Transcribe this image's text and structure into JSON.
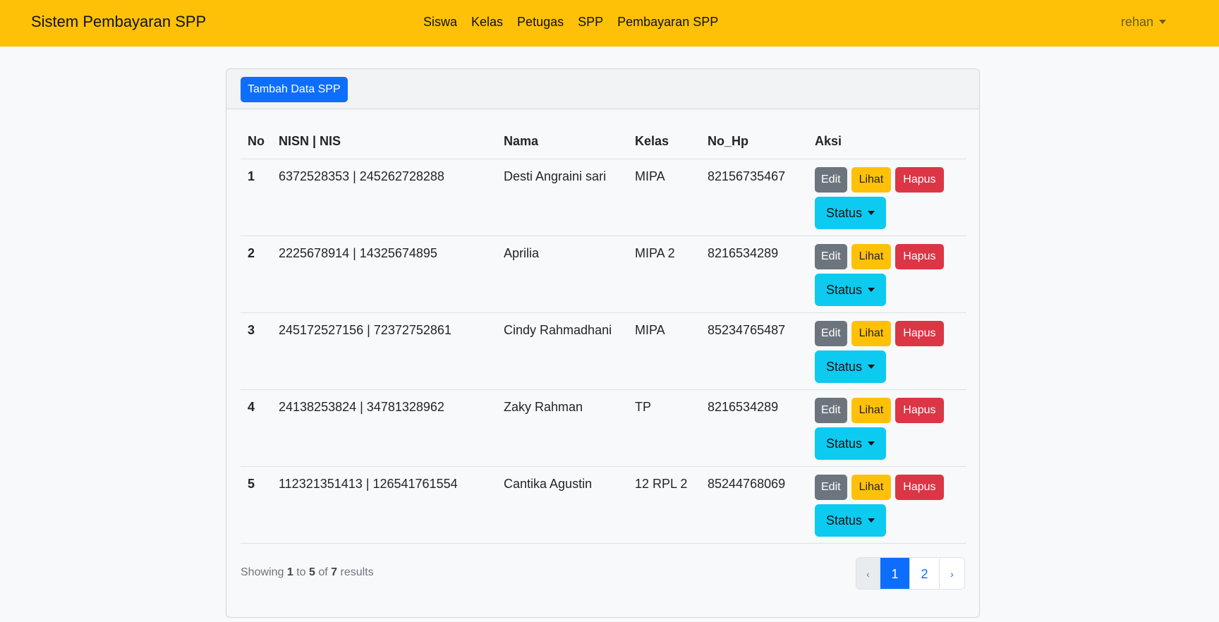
{
  "navbar": {
    "brand": "Sistem Pembayaran SPP",
    "links": [
      "Siswa",
      "Kelas",
      "Petugas",
      "SPP",
      "Pembayaran SPP"
    ],
    "user": "rehan"
  },
  "card": {
    "add_button": "Tambah Data SPP"
  },
  "table": {
    "headers": [
      "No",
      "NISN | NIS",
      "Nama",
      "Kelas",
      "No_Hp",
      "Aksi"
    ],
    "rows": [
      {
        "no": "1",
        "nisn_nis": "6372528353 | 245262728288",
        "nama": "Desti Angraini sari",
        "kelas": "MIPA",
        "no_hp": "82156735467"
      },
      {
        "no": "2",
        "nisn_nis": "2225678914 | 14325674895",
        "nama": "Aprilia",
        "kelas": "MIPA 2",
        "no_hp": "8216534289"
      },
      {
        "no": "3",
        "nisn_nis": "245172527156 | 72372752861",
        "nama": "Cindy Rahmadhani",
        "kelas": "MIPA",
        "no_hp": "85234765487"
      },
      {
        "no": "4",
        "nisn_nis": "24138253824 | 34781328962",
        "nama": "Zaky Rahman",
        "kelas": "TP",
        "no_hp": "8216534289"
      },
      {
        "no": "5",
        "nisn_nis": "112321351413 | 126541761554",
        "nama": "Cantika Agustin",
        "kelas": "12 RPL 2",
        "no_hp": "85244768069"
      }
    ],
    "actions": {
      "edit": "Edit",
      "lihat": "Lihat",
      "hapus": "Hapus",
      "status": "Status"
    }
  },
  "footer": {
    "showing": "Showing",
    "from": "1",
    "to_word": "to",
    "to": "5",
    "of_word": "of",
    "total": "7",
    "results": "results"
  },
  "pagination": {
    "prev": "‹",
    "pages": [
      "1",
      "2"
    ],
    "current": "1",
    "next": "›"
  },
  "colors": {
    "navbar": "#ffc107",
    "primary": "#0d6efd",
    "secondary": "#6c757d",
    "warning": "#ffc107",
    "danger": "#dc3545",
    "info": "#0dcaf0"
  }
}
